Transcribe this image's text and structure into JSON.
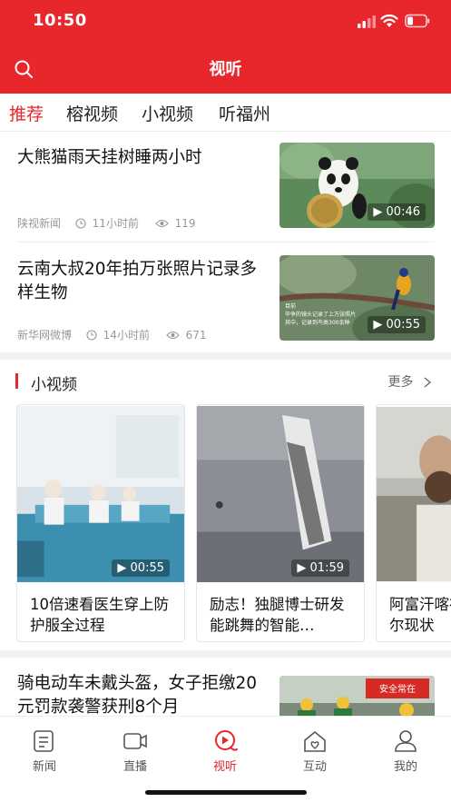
{
  "status_bar": {
    "time": "10:50"
  },
  "header": {
    "title": "视听"
  },
  "tabs": [
    {
      "label": "推荐",
      "active": true
    },
    {
      "label": "榕视频",
      "active": false
    },
    {
      "label": "小视频",
      "active": false
    },
    {
      "label": "听福州",
      "active": false
    }
  ],
  "news": [
    {
      "title": "大熊猫雨天挂树睡两小时",
      "source": "陕视新闻",
      "time": "11小时前",
      "views": "119",
      "duration": "00:46"
    },
    {
      "title": "云南大叔20年拍万张照片记录多样生物",
      "source": "新华网微博",
      "time": "14小时前",
      "views": "671",
      "duration": "00:55",
      "thumb_caption": "目前\n毕争的镜头记录了上万张照片\n其中，记录到鸟类300余种"
    },
    {
      "title": "骑电动车未戴头盔，女子拒缴20元罚款袭警获刑8个月",
      "thumb_text": "安全常在"
    }
  ],
  "short_videos": {
    "title": "小视频",
    "more": "更多",
    "items": [
      {
        "caption": "10倍速看医生穿上防护服全过程",
        "duration": "00:55"
      },
      {
        "caption": "励志！独腿博士研发能跳舞的智能…",
        "duration": "01:59"
      },
      {
        "caption": "阿富汗喀布尔现状",
        "duration": ""
      }
    ]
  },
  "tabbar": [
    {
      "label": "新闻",
      "icon": "news-icon"
    },
    {
      "label": "直播",
      "icon": "live-icon"
    },
    {
      "label": "视听",
      "icon": "play-icon",
      "active": true
    },
    {
      "label": "互动",
      "icon": "interact-icon"
    },
    {
      "label": "我的",
      "icon": "user-icon"
    }
  ],
  "colors": {
    "brand": "#e8272d",
    "text": "#222222",
    "muted": "#999999"
  }
}
